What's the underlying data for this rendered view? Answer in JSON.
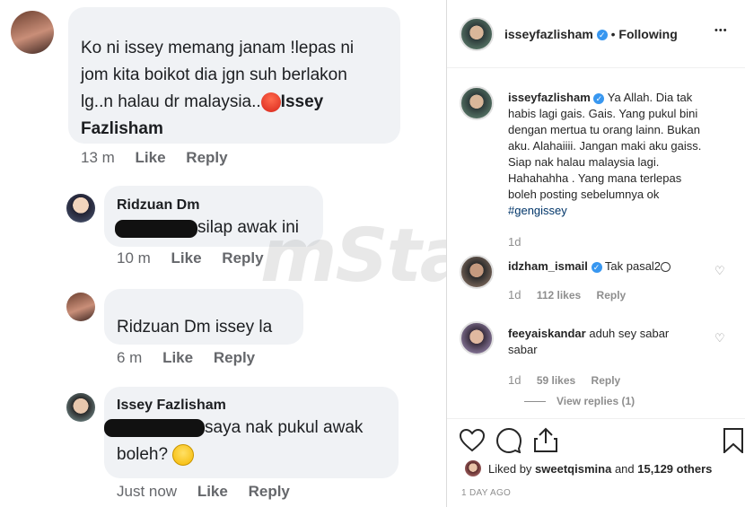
{
  "fb": {
    "comments": [
      {
        "text_lines": [
          "Ko ni issey memang janam !lepas ni",
          "jom kita boikot dia jgn suh berlakon",
          "lg..n halau dr malaysia.."
        ],
        "mention": "Issey Fazlisham",
        "time": "13 m",
        "like": "Like",
        "reply": "Reply"
      },
      {
        "name": "Ridzuan Dm",
        "text": "silap awak ini",
        "time": "10 m",
        "like": "Like",
        "reply": "Reply"
      },
      {
        "text": "Ridzuan Dm issey la",
        "time": "6 m",
        "like": "Like",
        "reply": "Reply"
      },
      {
        "name": "Issey Fazlisham",
        "text_line1": "saya nak pukul awak",
        "text_line2": "boleh?",
        "time": "Just now",
        "like": "Like",
        "reply": "Reply"
      }
    ]
  },
  "watermark": "mStar",
  "ig": {
    "header": {
      "username": "isseyfazlisham",
      "separator": "•",
      "follow_status": "Following",
      "more": "•••"
    },
    "caption": {
      "username": "isseyfazlisham",
      "lines": [
        "Ya Allah. Dia tak",
        "habis lagi gais. Gais. Yang pukul bini",
        "dengan mertua tu orang lainn. Bukan",
        "aku. Alahaiiii. Jangan maki aku gaiss.",
        "Siap nak halau malaysia lagi.",
        "Hahahahha . Yang mana terlepas",
        "boleh posting sebelumnya ok"
      ],
      "hashtag": "#gengissey",
      "age": "1d"
    },
    "comments": [
      {
        "username": "idzham_ismail",
        "text": "Tak pasal2",
        "age": "1d",
        "likes": "112 likes",
        "reply": "Reply"
      },
      {
        "username": "feeyaiskandar",
        "text_line1": "aduh sey sabar",
        "text_line2": "sabar",
        "age": "1d",
        "likes": "59 likes",
        "reply": "Reply",
        "view_replies": "View replies (1)"
      }
    ],
    "liked_by": {
      "prefix": "Liked by",
      "user": "sweetqismina",
      "and": "and",
      "count": "15,129 others"
    },
    "timestamp": "1 DAY AGO"
  }
}
